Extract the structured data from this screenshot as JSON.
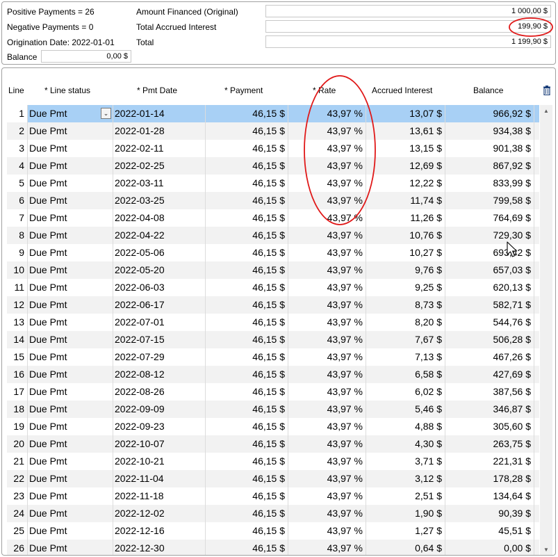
{
  "summary": {
    "positive_payments": "Positive Payments = 26",
    "negative_payments": "Negative Payments = 0",
    "origination_date": "Origination Date: 2022-01-01",
    "balance_label": "Balance",
    "balance_value": "0,00 $",
    "amount_financed_label": "Amount Financed (Original)",
    "amount_financed_value": "1 000,00 $",
    "total_interest_label": "Total Accrued Interest",
    "total_interest_value": "199,90 $",
    "total_label": "Total",
    "total_value": "1 199,90 $"
  },
  "table": {
    "headers": {
      "line": "Line",
      "status": "* Line status",
      "date": "* Pmt Date",
      "payment": "* Payment",
      "rate": "* Rate",
      "interest": "Accrued Interest",
      "balance": "Balance"
    },
    "delete_icon": "trash-icon",
    "rows": [
      {
        "line": "1",
        "status": "Due Pmt",
        "date": "2022-01-14",
        "payment": "46,15 $",
        "rate": "43,97 %",
        "interest": "13,07 $",
        "balance": "966,92 $"
      },
      {
        "line": "2",
        "status": "Due Pmt",
        "date": "2022-01-28",
        "payment": "46,15 $",
        "rate": "43,97 %",
        "interest": "13,61 $",
        "balance": "934,38 $"
      },
      {
        "line": "3",
        "status": "Due Pmt",
        "date": "2022-02-11",
        "payment": "46,15 $",
        "rate": "43,97 %",
        "interest": "13,15 $",
        "balance": "901,38 $"
      },
      {
        "line": "4",
        "status": "Due Pmt",
        "date": "2022-02-25",
        "payment": "46,15 $",
        "rate": "43,97 %",
        "interest": "12,69 $",
        "balance": "867,92 $"
      },
      {
        "line": "5",
        "status": "Due Pmt",
        "date": "2022-03-11",
        "payment": "46,15 $",
        "rate": "43,97 %",
        "interest": "12,22 $",
        "balance": "833,99 $"
      },
      {
        "line": "6",
        "status": "Due Pmt",
        "date": "2022-03-25",
        "payment": "46,15 $",
        "rate": "43,97 %",
        "interest": "11,74 $",
        "balance": "799,58 $"
      },
      {
        "line": "7",
        "status": "Due Pmt",
        "date": "2022-04-08",
        "payment": "46,15 $",
        "rate": "43,97 %",
        "interest": "11,26 $",
        "balance": "764,69 $"
      },
      {
        "line": "8",
        "status": "Due Pmt",
        "date": "2022-04-22",
        "payment": "46,15 $",
        "rate": "43,97 %",
        "interest": "10,76 $",
        "balance": "729,30 $"
      },
      {
        "line": "9",
        "status": "Due Pmt",
        "date": "2022-05-06",
        "payment": "46,15 $",
        "rate": "43,97 %",
        "interest": "10,27 $",
        "balance": "693,42 $"
      },
      {
        "line": "10",
        "status": "Due Pmt",
        "date": "2022-05-20",
        "payment": "46,15 $",
        "rate": "43,97 %",
        "interest": "9,76 $",
        "balance": "657,03 $"
      },
      {
        "line": "11",
        "status": "Due Pmt",
        "date": "2022-06-03",
        "payment": "46,15 $",
        "rate": "43,97 %",
        "interest": "9,25 $",
        "balance": "620,13 $"
      },
      {
        "line": "12",
        "status": "Due Pmt",
        "date": "2022-06-17",
        "payment": "46,15 $",
        "rate": "43,97 %",
        "interest": "8,73 $",
        "balance": "582,71 $"
      },
      {
        "line": "13",
        "status": "Due Pmt",
        "date": "2022-07-01",
        "payment": "46,15 $",
        "rate": "43,97 %",
        "interest": "8,20 $",
        "balance": "544,76 $"
      },
      {
        "line": "14",
        "status": "Due Pmt",
        "date": "2022-07-15",
        "payment": "46,15 $",
        "rate": "43,97 %",
        "interest": "7,67 $",
        "balance": "506,28 $"
      },
      {
        "line": "15",
        "status": "Due Pmt",
        "date": "2022-07-29",
        "payment": "46,15 $",
        "rate": "43,97 %",
        "interest": "7,13 $",
        "balance": "467,26 $"
      },
      {
        "line": "16",
        "status": "Due Pmt",
        "date": "2022-08-12",
        "payment": "46,15 $",
        "rate": "43,97 %",
        "interest": "6,58 $",
        "balance": "427,69 $"
      },
      {
        "line": "17",
        "status": "Due Pmt",
        "date": "2022-08-26",
        "payment": "46,15 $",
        "rate": "43,97 %",
        "interest": "6,02 $",
        "balance": "387,56 $"
      },
      {
        "line": "18",
        "status": "Due Pmt",
        "date": "2022-09-09",
        "payment": "46,15 $",
        "rate": "43,97 %",
        "interest": "5,46 $",
        "balance": "346,87 $"
      },
      {
        "line": "19",
        "status": "Due Pmt",
        "date": "2022-09-23",
        "payment": "46,15 $",
        "rate": "43,97 %",
        "interest": "4,88 $",
        "balance": "305,60 $"
      },
      {
        "line": "20",
        "status": "Due Pmt",
        "date": "2022-10-07",
        "payment": "46,15 $",
        "rate": "43,97 %",
        "interest": "4,30 $",
        "balance": "263,75 $"
      },
      {
        "line": "21",
        "status": "Due Pmt",
        "date": "2022-10-21",
        "payment": "46,15 $",
        "rate": "43,97 %",
        "interest": "3,71 $",
        "balance": "221,31 $"
      },
      {
        "line": "22",
        "status": "Due Pmt",
        "date": "2022-11-04",
        "payment": "46,15 $",
        "rate": "43,97 %",
        "interest": "3,12 $",
        "balance": "178,28 $"
      },
      {
        "line": "23",
        "status": "Due Pmt",
        "date": "2022-11-18",
        "payment": "46,15 $",
        "rate": "43,97 %",
        "interest": "2,51 $",
        "balance": "134,64 $"
      },
      {
        "line": "24",
        "status": "Due Pmt",
        "date": "2022-12-02",
        "payment": "46,15 $",
        "rate": "43,97 %",
        "interest": "1,90 $",
        "balance": "90,39 $"
      },
      {
        "line": "25",
        "status": "Due Pmt",
        "date": "2022-12-16",
        "payment": "46,15 $",
        "rate": "43,97 %",
        "interest": "1,27 $",
        "balance": "45,51 $"
      },
      {
        "line": "26",
        "status": "Due Pmt",
        "date": "2022-12-30",
        "payment": "46,15 $",
        "rate": "43,97 %",
        "interest": "0,64 $",
        "balance": "0,00 $"
      }
    ],
    "selected_row": 0
  },
  "colors": {
    "selected_row": "#a8d0f5",
    "alt_row": "#f2f2f2",
    "annotation": "#e01818"
  }
}
